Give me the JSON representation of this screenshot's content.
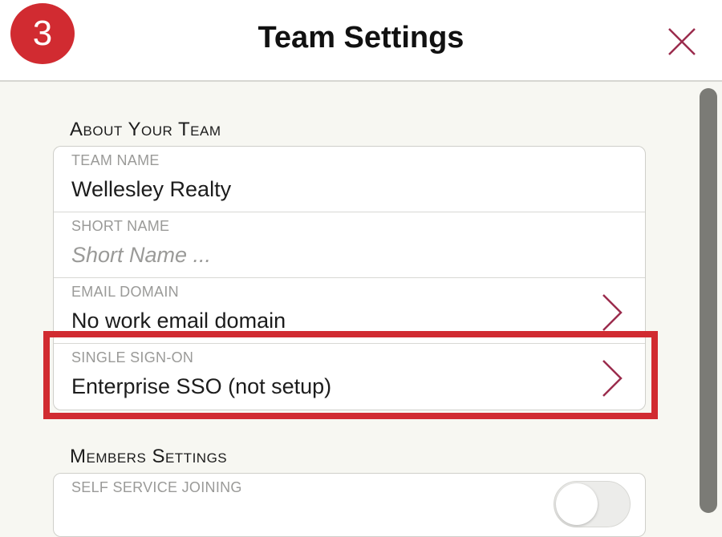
{
  "step_badge": "3",
  "header": {
    "title": "Team Settings"
  },
  "about_section": {
    "title": "About Your Team",
    "fields": [
      {
        "label": "TEAM NAME",
        "value": "Wellesley Realty"
      },
      {
        "label": "SHORT NAME",
        "placeholder": "Short Name ..."
      },
      {
        "label": "EMAIL DOMAIN",
        "value": "No work email domain"
      },
      {
        "label": "SINGLE SIGN-ON",
        "value": "Enterprise SSO (not setup)"
      }
    ]
  },
  "members_section": {
    "title": "Members Settings",
    "fields": [
      {
        "label": "SELF SERVICE JOINING"
      }
    ]
  },
  "colors": {
    "accent": "#d12b31",
    "chevron": "#9b2c4d"
  }
}
